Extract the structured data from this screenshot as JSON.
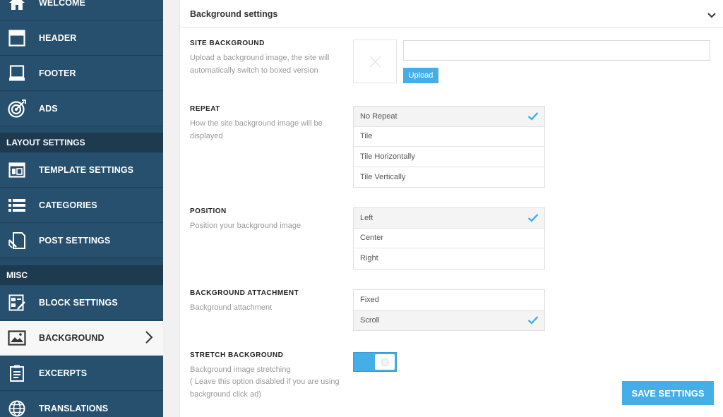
{
  "sidebar": {
    "items": [
      {
        "label": "WELCOME",
        "icon": "home-icon"
      },
      {
        "label": "HEADER",
        "icon": "header-icon"
      },
      {
        "label": "FOOTER",
        "icon": "footer-icon"
      },
      {
        "label": "ADS",
        "icon": "target-icon"
      },
      {
        "label": "TEMPLATE SETTINGS",
        "icon": "template-icon"
      },
      {
        "label": "CATEGORIES",
        "icon": "list-icon"
      },
      {
        "label": "POST SETTINGS",
        "icon": "post-icon"
      },
      {
        "label": "BLOCK SETTINGS",
        "icon": "block-icon"
      },
      {
        "label": "BACKGROUND",
        "icon": "image-icon"
      },
      {
        "label": "EXCERPTS",
        "icon": "document-icon"
      },
      {
        "label": "TRANSLATIONS",
        "icon": "globe-icon"
      }
    ],
    "sections": {
      "layout": "LAYOUT SETTINGS",
      "misc": "MISC"
    }
  },
  "panel": {
    "title": "Background settings",
    "site_background": {
      "title": "SITE BACKGROUND",
      "desc": "Upload a background image, the site will automatically switch to boxed version",
      "url_value": "",
      "upload_label": "Upload"
    },
    "repeat": {
      "title": "REPEAT",
      "desc": "How the site background image will be displayed",
      "options": [
        "No Repeat",
        "Tile",
        "Tile Horizontally",
        "Tile Vertically"
      ],
      "selected": "No Repeat"
    },
    "position": {
      "title": "POSITION",
      "desc": "Position your background image",
      "options": [
        "Left",
        "Center",
        "Right"
      ],
      "selected": "Left"
    },
    "attachment": {
      "title": "BACKGROUND ATTACHMENT",
      "desc": "Background attachment",
      "options": [
        "Fixed",
        "Scroll"
      ],
      "selected": "Scroll"
    },
    "stretch": {
      "title": "STRETCH BACKGROUND",
      "desc1": "Background image stretching",
      "desc2": "( Leave this option disabled if you are using background click ad)",
      "enabled": true
    },
    "save_label": "SAVE SETTINGS"
  },
  "colors": {
    "sidebar_bg": "#26506d",
    "section_bg": "#1d3a4f",
    "accent": "#45aee6",
    "check": "#45aee6"
  }
}
